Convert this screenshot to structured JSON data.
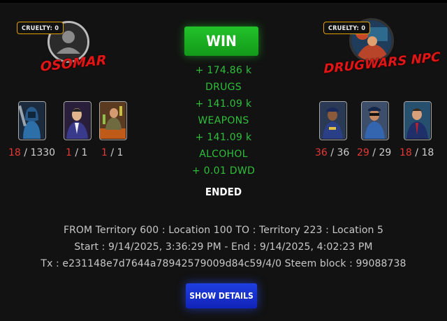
{
  "attacker": {
    "cruelty_label": "CRUELTY: 0",
    "name": "OSOMAR",
    "units": [
      {
        "alive": "18",
        "total": "1330",
        "icon": "hooded-thug-icon"
      },
      {
        "alive": "1",
        "total": "1",
        "icon": "suited-boss-icon"
      },
      {
        "alive": "1",
        "total": "1",
        "icon": "bartender-icon"
      }
    ]
  },
  "defender": {
    "cruelty_label": "CRUELTY: 0",
    "name": "DRUGWARS NPC",
    "units": [
      {
        "alive": "36",
        "total": "36",
        "icon": "police-officer-icon"
      },
      {
        "alive": "29",
        "total": "29",
        "icon": "police-sunglasses-icon"
      },
      {
        "alive": "18",
        "total": "18",
        "icon": "businessman-icon"
      }
    ]
  },
  "result": {
    "label": "WIN",
    "loot": [
      "+ 174.86 k",
      "DRUGS",
      "+ 141.09 k",
      "WEAPONS",
      "+ 141.09 k",
      "ALCOHOL",
      "+ 0.01 DWD"
    ],
    "status": "ENDED"
  },
  "info": {
    "route": "FROM Territory 600 : Location 100 TO : Territory 223 : Location 5",
    "time": "Start : 9/14/2025, 3:36:29 PM - End : 9/14/2025, 4:02:23 PM",
    "tx": "Tx : e231148e7d7644a78942579009d84c59/4/0 Steem block : 99088738"
  },
  "details_button": "SHOW DETAILS",
  "colors": {
    "background": "#121212",
    "win": "#1fae26",
    "loot_text": "#2fbf3a",
    "alive_count": "#e53935",
    "name": "#e01616",
    "badge_border": "#e0a000",
    "details": "#1830d0"
  }
}
